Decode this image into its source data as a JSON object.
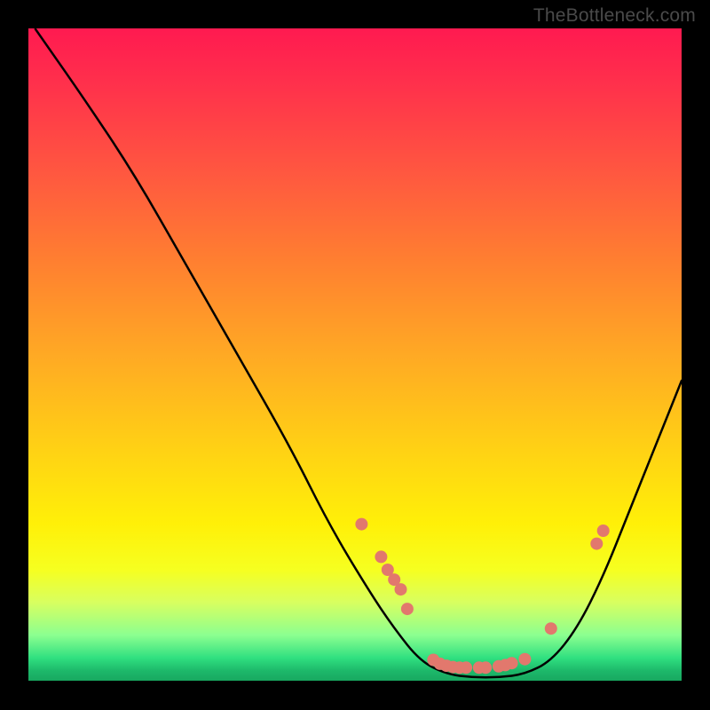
{
  "watermark": "TheBottleneck.com",
  "chart_data": {
    "type": "line",
    "title": "",
    "xlabel": "",
    "ylabel": "",
    "x_range": [
      0,
      100
    ],
    "y_range": [
      0,
      100
    ],
    "curve": [
      {
        "x": 1,
        "y": 100
      },
      {
        "x": 8,
        "y": 90
      },
      {
        "x": 16,
        "y": 78
      },
      {
        "x": 24,
        "y": 64
      },
      {
        "x": 32,
        "y": 50
      },
      {
        "x": 40,
        "y": 36
      },
      {
        "x": 46,
        "y": 24
      },
      {
        "x": 52,
        "y": 14
      },
      {
        "x": 56,
        "y": 8
      },
      {
        "x": 60,
        "y": 3
      },
      {
        "x": 64,
        "y": 1
      },
      {
        "x": 68,
        "y": 0.5
      },
      {
        "x": 72,
        "y": 0.5
      },
      {
        "x": 76,
        "y": 1
      },
      {
        "x": 80,
        "y": 3
      },
      {
        "x": 84,
        "y": 8
      },
      {
        "x": 88,
        "y": 16
      },
      {
        "x": 92,
        "y": 26
      },
      {
        "x": 96,
        "y": 36
      },
      {
        "x": 100,
        "y": 46
      }
    ],
    "markers": [
      {
        "x": 51,
        "y": 24
      },
      {
        "x": 54,
        "y": 19
      },
      {
        "x": 55,
        "y": 17
      },
      {
        "x": 56,
        "y": 15.5
      },
      {
        "x": 57,
        "y": 14
      },
      {
        "x": 58,
        "y": 11
      },
      {
        "x": 62,
        "y": 3.2
      },
      {
        "x": 63,
        "y": 2.6
      },
      {
        "x": 64,
        "y": 2.3
      },
      {
        "x": 65,
        "y": 2.1
      },
      {
        "x": 66,
        "y": 2.0
      },
      {
        "x": 67,
        "y": 2.0
      },
      {
        "x": 69,
        "y": 2.0
      },
      {
        "x": 70,
        "y": 2.0
      },
      {
        "x": 72,
        "y": 2.2
      },
      {
        "x": 73,
        "y": 2.4
      },
      {
        "x": 74,
        "y": 2.7
      },
      {
        "x": 76,
        "y": 3.3
      },
      {
        "x": 80,
        "y": 8
      },
      {
        "x": 87,
        "y": 21
      },
      {
        "x": 88,
        "y": 23
      }
    ],
    "marker_color": "#e2786d",
    "curve_color": "#000000",
    "curve_width": 2.5,
    "marker_radius": 7
  }
}
